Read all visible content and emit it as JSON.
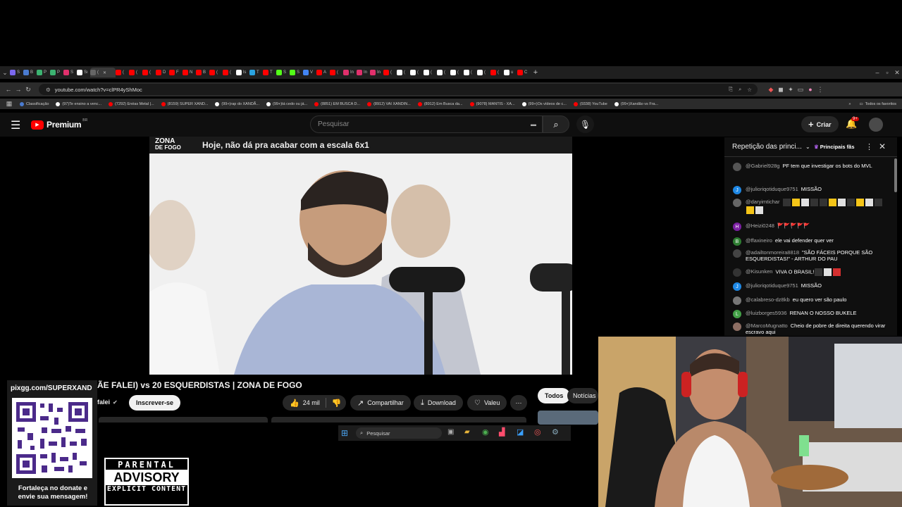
{
  "browser": {
    "tabs": [
      {
        "label": "S",
        "color": "#7b68ee"
      },
      {
        "label": "B",
        "color": "#4a7bd0"
      },
      {
        "label": "P",
        "color": "#3cb371"
      },
      {
        "label": "P",
        "color": "#3cb371"
      },
      {
        "label": "S",
        "color": "#e1306c"
      },
      {
        "label": "Sı",
        "color": "#ffffff"
      },
      {
        "label": "(",
        "color": "#666",
        "active": true
      },
      {
        "label": "(",
        "color": "#ff0000"
      },
      {
        "label": "(",
        "color": "#ff0000"
      },
      {
        "label": "(",
        "color": "#ff0000"
      },
      {
        "label": "D",
        "color": "#ff0000"
      },
      {
        "label": "F",
        "color": "#ff0000"
      },
      {
        "label": "N",
        "color": "#ff0000"
      },
      {
        "label": "B",
        "color": "#ff0000"
      },
      {
        "label": "(",
        "color": "#ff0000"
      },
      {
        "label": "(",
        "color": "#ff0000"
      },
      {
        "label": "ls",
        "color": "#ffffff"
      },
      {
        "label": "T",
        "color": "#2aa3e0"
      },
      {
        "label": "T",
        "color": "#ff0000"
      },
      {
        "label": "S",
        "color": "#53fc18"
      },
      {
        "label": "S",
        "color": "#53fc18"
      },
      {
        "label": "V",
        "color": "#4285f4"
      },
      {
        "label": "A",
        "color": "#ff0000"
      },
      {
        "label": "(",
        "color": "#ff0000"
      },
      {
        "label": "In",
        "color": "#e1306c"
      },
      {
        "label": "In",
        "color": "#e1306c"
      },
      {
        "label": "In",
        "color": "#e1306c"
      },
      {
        "label": "(",
        "color": "#ff0000"
      },
      {
        "label": "(",
        "color": "#ffffff"
      },
      {
        "label": "(",
        "color": "#ffffff"
      },
      {
        "label": "(",
        "color": "#ffffff"
      },
      {
        "label": "(",
        "color": "#ffffff"
      },
      {
        "label": "(",
        "color": "#ffffff"
      },
      {
        "label": "(",
        "color": "#ffffff"
      },
      {
        "label": "(",
        "color": "#ffffff"
      },
      {
        "label": "(",
        "color": "#ff0000"
      },
      {
        "label": "u",
        "color": "#ffffff"
      },
      {
        "label": "C",
        "color": "#ff0000"
      }
    ],
    "url": "youtube.com/watch?v=clPR4yShMoc",
    "bookmarks": [
      {
        "label": "Classificação",
        "color": "#4a7bd0"
      },
      {
        "label": "(97)Te ensino a venc...",
        "color": "#ffffff"
      },
      {
        "label": "(7292) Enéas Metal |...",
        "color": "#ff0000"
      },
      {
        "label": "(8159) SUPER XAND...",
        "color": "#ff0000"
      },
      {
        "label": "(99+)rap do XANDÃ...",
        "color": "#ffffff"
      },
      {
        "label": "(99+)tá cedo ou já...",
        "color": "#ffffff"
      },
      {
        "label": "(8851) EM BUSCA D...",
        "color": "#ff0000"
      },
      {
        "label": "(8912) VAI XANDIN...",
        "color": "#ff0000"
      },
      {
        "label": "(8912) Em Busca da...",
        "color": "#ff0000"
      },
      {
        "label": "(9078) MANTIS - XA...",
        "color": "#ff0000"
      },
      {
        "label": "(99+)Os vídeos de c...",
        "color": "#ffffff"
      },
      {
        "label": "(9338) YouTube",
        "color": "#ff0000"
      },
      {
        "label": "(99+)Xandão vs Fra...",
        "color": "#ffffff"
      }
    ],
    "all_bookmarks": "Todos os favoritos"
  },
  "youtube": {
    "logo": "Premium",
    "region": "BR",
    "search_placeholder": "Pesquisar",
    "create_label": "Criar",
    "notif_count": "9+",
    "video_banner_logo_top": "ZONA",
    "video_banner_logo_bottom": "DE FOGO",
    "video_banner_text": "Hoje, não dá pra acabar com a escala 6x1",
    "video_title": "ÃE FALEI) vs 20 ESQUERDISTAS | ZONA DE FOGO",
    "channel_partial": "falei",
    "subscribe_label": "Inscrever-se",
    "likes": "24 mil",
    "share_label": "Compartilhar",
    "download_label": "Download",
    "thanks_label": "Valeu",
    "filter_all": "Todos",
    "filter_news": "Notícias"
  },
  "chat": {
    "header_title": "Repetição das princi...",
    "top_fans": "Principais fãs",
    "messages": [
      {
        "author": "@Gabriel928g",
        "text": "PF tem que investigar os bots do MVL",
        "avatar": "",
        "avatar_color": "#555"
      },
      {
        "author": "@julioriqotiduque9751",
        "text": "MISSÃO",
        "avatar": "J",
        "avatar_color": "#1e88e5"
      },
      {
        "author": "@daryimtichar",
        "text": "",
        "avatar": "",
        "avatar_color": "#666"
      },
      {
        "author": "@Heizi0248",
        "text": "🚩🚩🚩🚩🚩",
        "avatar": "H",
        "avatar_color": "#7b1fa2"
      },
      {
        "author": "@ffaxineiro",
        "text": "ele vai defender quer ver",
        "avatar": "B",
        "avatar_color": "#2e7d32"
      },
      {
        "author": "@adailtonmoreira8818",
        "text": "\"SÃO FÁCEIS PORQUE SÃO ESQUERDISTAS!\" - ARTHUR DO PAU",
        "avatar": "",
        "avatar_color": "#444"
      },
      {
        "author": "@Kisunken",
        "text": "VIVA O BRASIL!",
        "avatar": "",
        "avatar_color": "#333"
      },
      {
        "author": "@julioriqotiduque9751",
        "text": "MISSÃO",
        "avatar": "J",
        "avatar_color": "#1e88e5"
      },
      {
        "author": "@calabreso-dz8kb",
        "text": "eu quero ver são paulo",
        "avatar": "",
        "avatar_color": "#777"
      },
      {
        "author": "@luizborges5936",
        "text": "RENAN O NOSSO BUKELE",
        "avatar": "L",
        "avatar_color": "#43a047"
      },
      {
        "author": "@MarcoMugnatto",
        "text": "Cheio de pobre de direita querendo virar escravo aqui",
        "avatar": "",
        "avatar_color": "#8d6e63"
      }
    ]
  },
  "taskbar": {
    "search_placeholder": "Pesquisar"
  },
  "overlay": {
    "qr_url": "pixgg.com/SUPERXAND",
    "donate_text": "Fortaleça no donate e envie sua mensagem!",
    "parental": "PARENTAL",
    "advisory": "ADVISORY",
    "explicit": "EXPLICIT CONTENT"
  }
}
